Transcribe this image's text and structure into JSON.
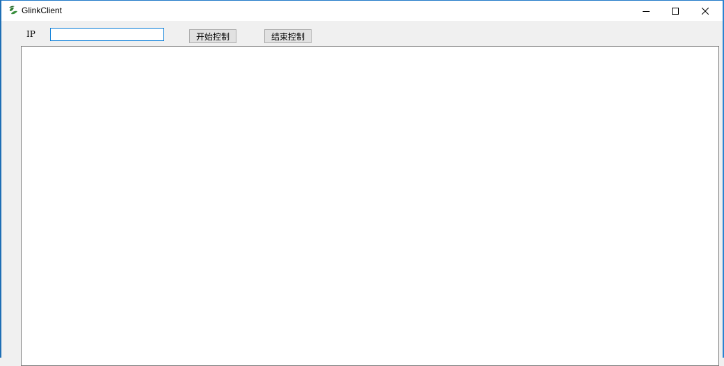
{
  "window": {
    "title": "GlinkClient"
  },
  "toolbar": {
    "ip_label": "IP",
    "ip_value": "",
    "start_label": "开始控制",
    "stop_label": "结束控制"
  },
  "icons": {
    "app": "glinkclient-app-icon",
    "minimize": "minimize-icon",
    "maximize": "maximize-icon",
    "close": "close-icon"
  },
  "colors": {
    "titlebar": "#ffffff",
    "window_bg": "#f0f0f0",
    "accent_border": "#0078d7",
    "app_icon_green": "#2e7d32"
  }
}
